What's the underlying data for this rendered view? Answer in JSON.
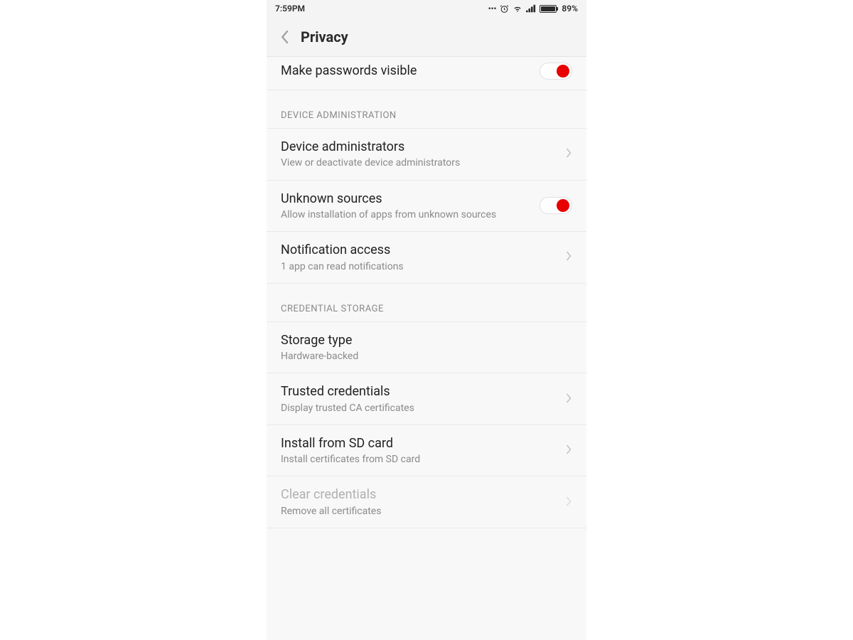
{
  "status_bar": {
    "time": "7:59PM",
    "battery_percent": "89%"
  },
  "header": {
    "title": "Privacy"
  },
  "rows": {
    "make_passwords_visible": {
      "title": "Make passwords visible"
    }
  },
  "sections": {
    "device_admin": {
      "label": "DEVICE ADMINISTRATION",
      "items": {
        "device_administrators": {
          "title": "Device administrators",
          "subtitle": "View or deactivate device administrators"
        },
        "unknown_sources": {
          "title": "Unknown sources",
          "subtitle": "Allow installation of apps from unknown sources"
        },
        "notification_access": {
          "title": "Notification access",
          "subtitle": "1 app can read notifications"
        }
      }
    },
    "credential_storage": {
      "label": "CREDENTIAL STORAGE",
      "items": {
        "storage_type": {
          "title": "Storage type",
          "subtitle": "Hardware-backed"
        },
        "trusted_credentials": {
          "title": "Trusted credentials",
          "subtitle": "Display trusted CA certificates"
        },
        "install_sd": {
          "title": "Install from SD card",
          "subtitle": "Install certificates from SD card"
        },
        "clear_credentials": {
          "title": "Clear credentials",
          "subtitle": "Remove all certificates"
        }
      }
    }
  }
}
